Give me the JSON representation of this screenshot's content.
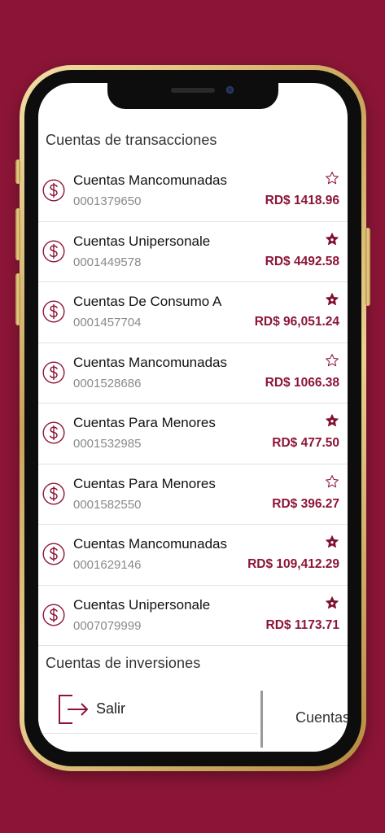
{
  "sections": {
    "transactions_title": "Cuentas de transacciones",
    "investments_title": "Cuentas de inversiones"
  },
  "accounts": [
    {
      "name": "Cuentas Mancomunadas",
      "number": "0001379650",
      "amount": "RD$ 1418.96",
      "favorite": false
    },
    {
      "name": "Cuentas Unipersonale",
      "number": "0001449578",
      "amount": "RD$ 4492.58",
      "favorite": true
    },
    {
      "name": "Cuentas De Consumo A",
      "number": "0001457704",
      "amount": "RD$ 96,051.24",
      "favorite": true
    },
    {
      "name": "Cuentas Mancomunadas",
      "number": "0001528686",
      "amount": "RD$ 1066.38",
      "favorite": false
    },
    {
      "name": "Cuentas Para Menores",
      "number": "0001532985",
      "amount": "RD$ 477.50",
      "favorite": true
    },
    {
      "name": "Cuentas Para Menores",
      "number": "0001582550",
      "amount": "RD$ 396.27",
      "favorite": false
    },
    {
      "name": "Cuentas Mancomunadas",
      "number": "0001629146",
      "amount": "RD$ 109,412.29",
      "favorite": true
    },
    {
      "name": "Cuentas Unipersonale",
      "number": "0007079999",
      "amount": "RD$ 1173.71",
      "favorite": true
    }
  ],
  "menu": {
    "exit_label": "Salir",
    "right_peek_label": "Cuentas"
  },
  "colors": {
    "brand": "#8c1537",
    "text": "#111111",
    "muted": "#8a8a8a"
  },
  "icons": {
    "account": "dollar-circle-icon",
    "favorite": "star-icon",
    "exit": "exit-icon"
  }
}
